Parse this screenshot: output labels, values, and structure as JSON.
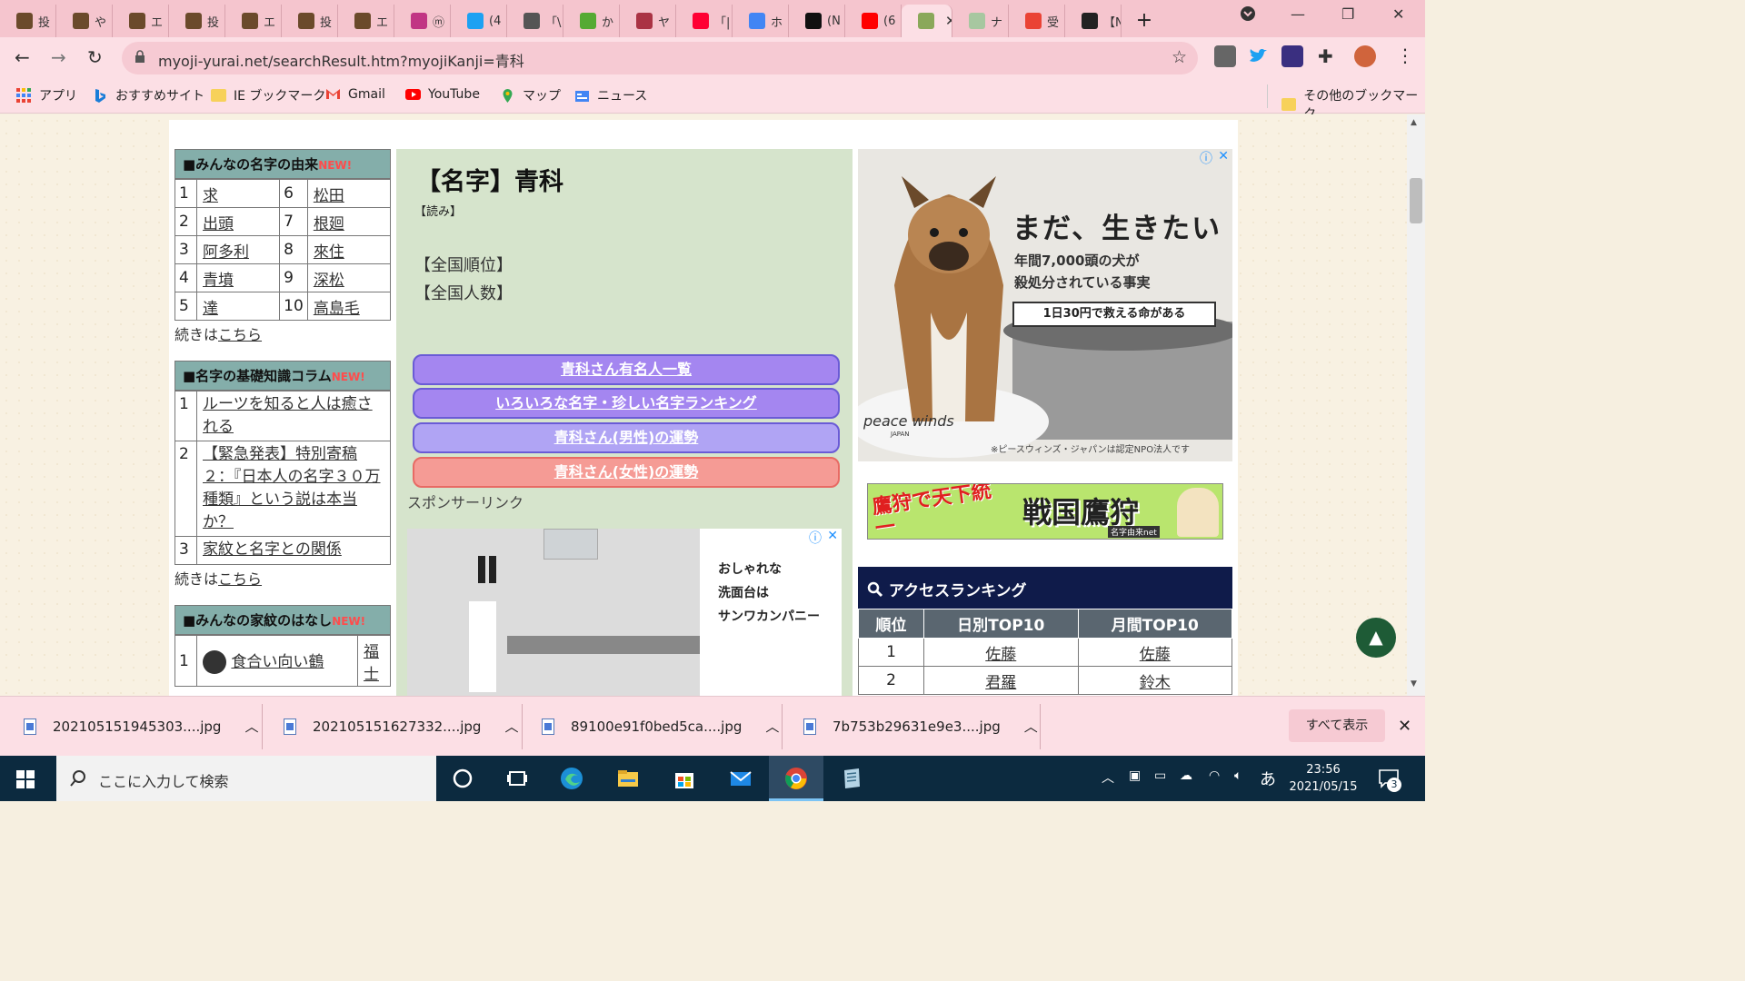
{
  "tabs": [
    {
      "label": "投",
      "color": "#6b4a2b"
    },
    {
      "label": "や",
      "color": "#6b4a2b"
    },
    {
      "label": "エ",
      "color": "#6b4a2b"
    },
    {
      "label": "投",
      "color": "#6b4a2b"
    },
    {
      "label": "エ",
      "color": "#6b4a2b"
    },
    {
      "label": "投",
      "color": "#6b4a2b"
    },
    {
      "label": "エ",
      "color": "#6b4a2b"
    },
    {
      "label": "ⓜ",
      "color": "#c13584"
    },
    {
      "label": "(4",
      "color": "#1da1f2"
    },
    {
      "label": "「\\",
      "color": "#555555"
    },
    {
      "label": "か",
      "color": "#55aa33"
    },
    {
      "label": "ヤ",
      "color": "#aa3344"
    },
    {
      "label": "「|",
      "color": "#ff0033"
    },
    {
      "label": "ホ",
      "color": "#4285f4"
    },
    {
      "label": "(N",
      "color": "#111111"
    },
    {
      "label": "(6",
      "color": "#ff0000"
    },
    {
      "label": "",
      "color": "#8aa85a"
    },
    {
      "label": "ナ",
      "color": "#a7c7a0"
    },
    {
      "label": "受",
      "color": "#ea4335"
    },
    {
      "label": "【N",
      "color": "#222222"
    }
  ],
  "address": {
    "url": "myoji-yurai.net/searchResult.htm?myojiKanji=青科"
  },
  "bookmarks": [
    {
      "label": "アプリ"
    },
    {
      "label": "おすすめサイト"
    },
    {
      "label": "IE ブックマーク"
    },
    {
      "label": "Gmail"
    },
    {
      "label": "YouTube"
    },
    {
      "label": "マップ"
    },
    {
      "label": "ニュース"
    }
  ],
  "other_bookmarks": "その他のブックマーク",
  "left": {
    "box1": {
      "title": "■みんなの名字の由来",
      "new": "NEW!",
      "rows": [
        [
          "1",
          "求",
          "6",
          "松田"
        ],
        [
          "2",
          "出頭",
          "7",
          "根廻"
        ],
        [
          "3",
          "阿多利",
          "8",
          "來住"
        ],
        [
          "4",
          "青墳",
          "9",
          "深松"
        ],
        [
          "5",
          "達",
          "10",
          "高島毛"
        ]
      ],
      "more_prefix": "続きは",
      "more_link": "こちら"
    },
    "box2": {
      "title": "■名字の基礎知識コラム",
      "new": "NEW!",
      "rows": [
        [
          "1",
          "ルーツを知ると人は癒される"
        ],
        [
          "2",
          "【緊急発表】特別寄稿２：『日本人の名字３０万種類』という説は本当か？"
        ],
        [
          "3",
          "家紋と名字との関係"
        ]
      ],
      "more_prefix": "続きは",
      "more_link": "こちら"
    },
    "box3": {
      "title": "■みんなの家紋のはなし",
      "new": "NEW!",
      "rows": [
        [
          "1",
          "食合い向い鶴",
          "福士"
        ]
      ]
    }
  },
  "main": {
    "title": "【名字】青科",
    "yomi": "【読み】",
    "national_rank": "【全国順位】",
    "national_count": "【全国人数】",
    "buttons": [
      {
        "label": "青科さん有名人一覧",
        "color": "#a486f0"
      },
      {
        "label": "いろいろな名字・珍しい名字ランキング",
        "color": "#a486f0"
      },
      {
        "label": "青科さん(男性)の運勢",
        "color": "#b0a4f4"
      },
      {
        "label": "青科さん(女性)の運勢",
        "color": "#f59b95"
      }
    ],
    "sponsor": "スポンサーリンク",
    "ad_text": [
      "おしゃれな",
      "洗面台は",
      "サンワカンパニー"
    ]
  },
  "right": {
    "dog_ad": {
      "headline": "まだ、生きたい",
      "line1": "年間7,000頭の犬が",
      "line2": "殺処分されている事実",
      "box": "1日30円で救える命がある",
      "brand": "peace winds",
      "brand_sub": "JAPAN",
      "note": "※ピースウィンズ・ジャパンは認定NPO法人です"
    },
    "hawk_ad": {
      "left": "鷹狩で天下統一",
      "right": "戦国鷹狩",
      "credit": "名字由来net"
    },
    "access": {
      "title": "アクセスランキング",
      "headers": [
        "順位",
        "日別TOP10",
        "月間TOP10"
      ],
      "rows": [
        [
          "1",
          "佐藤",
          "佐藤"
        ],
        [
          "2",
          "君羅",
          "鈴木"
        ]
      ]
    }
  },
  "downloads": [
    {
      "name": "202105151945303....jpg"
    },
    {
      "name": "202105151627332....jpg"
    },
    {
      "name": "89100e91f0bed5ca....jpg"
    },
    {
      "name": "7b753b29631e9e3....jpg"
    }
  ],
  "show_all": "すべて表示",
  "taskbar": {
    "search_placeholder": "ここに入力して検索",
    "ime": "あ",
    "time": "23:56",
    "date": "2021/05/15",
    "notifications": "3"
  }
}
